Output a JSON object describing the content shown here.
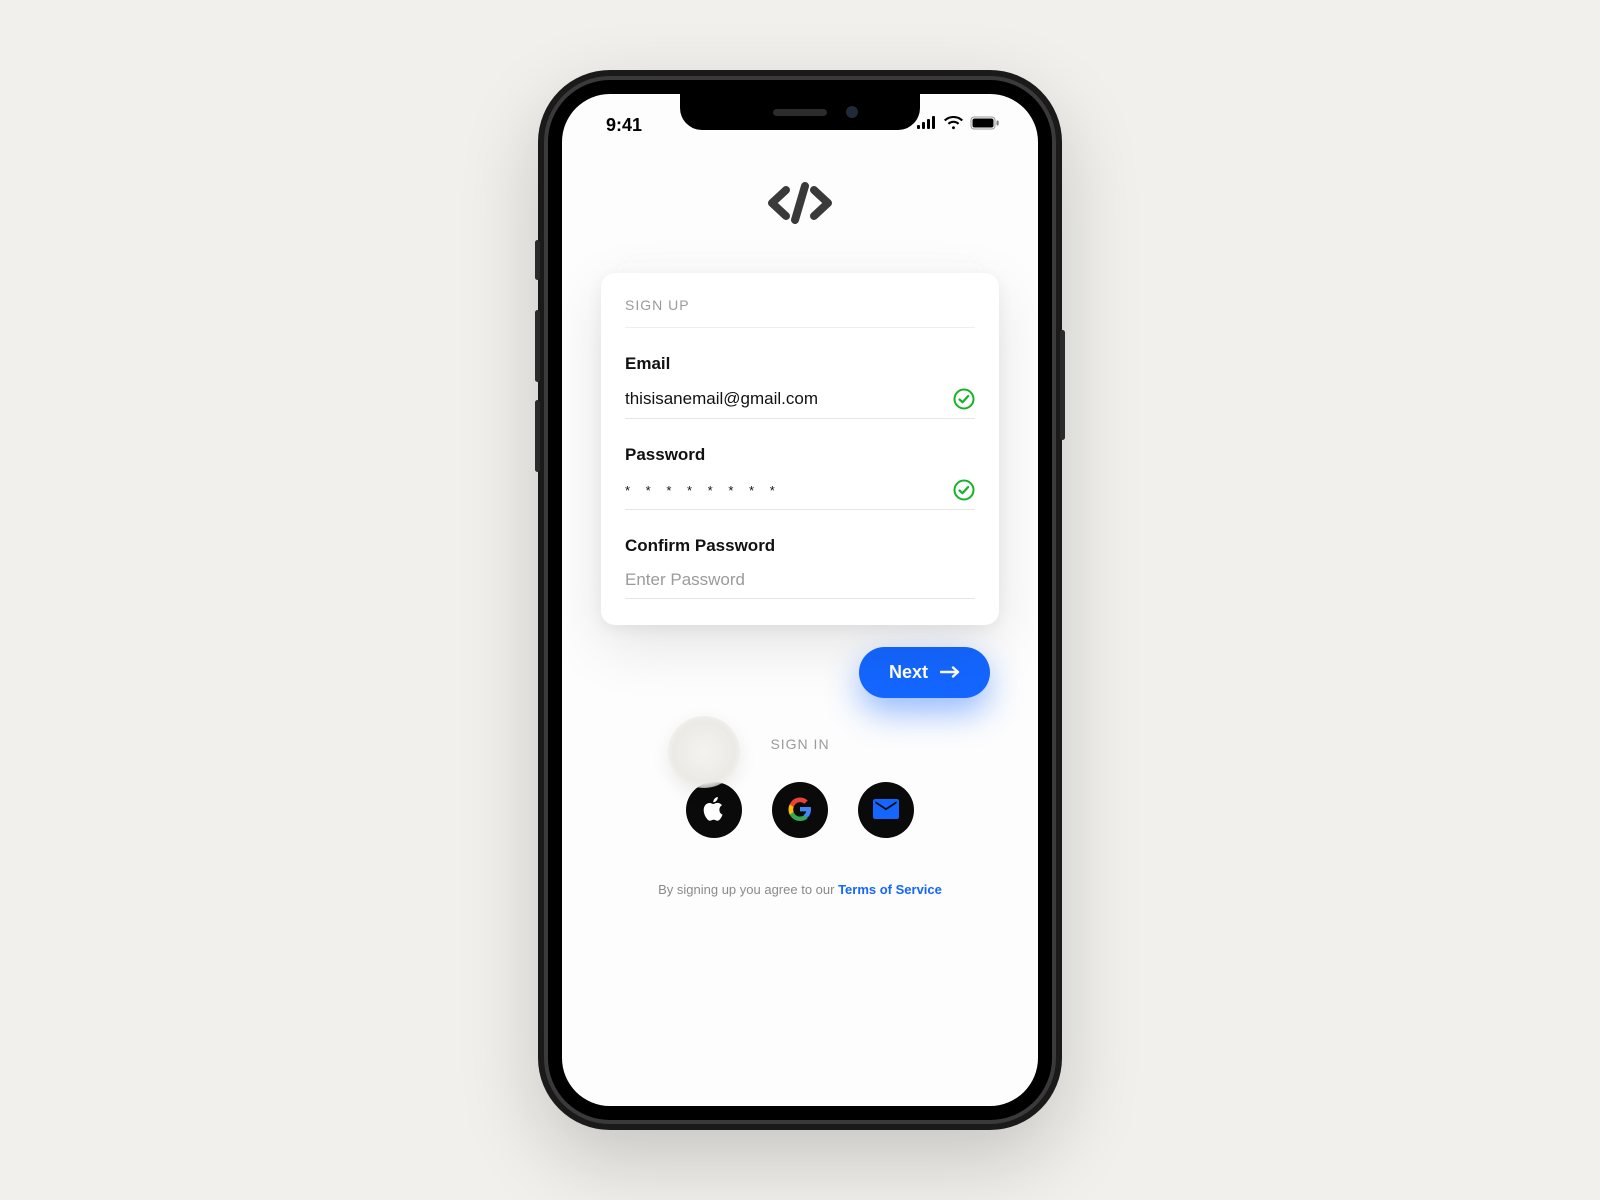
{
  "status": {
    "time": "9:41"
  },
  "card": {
    "title": "SIGN UP",
    "email_label": "Email",
    "email_value": "thisisanemail@gmail.com",
    "password_label": "Password",
    "password_value": "* * * * * * * *",
    "confirm_label": "Confirm Password",
    "confirm_placeholder": "Enter Password"
  },
  "next_label": "Next",
  "signin_label": "SIGN IN",
  "tos_prefix": "By signing up you agree to our ",
  "tos_link": "Terms of Service",
  "colors": {
    "accent": "#1466ff",
    "valid": "#17b22a"
  }
}
